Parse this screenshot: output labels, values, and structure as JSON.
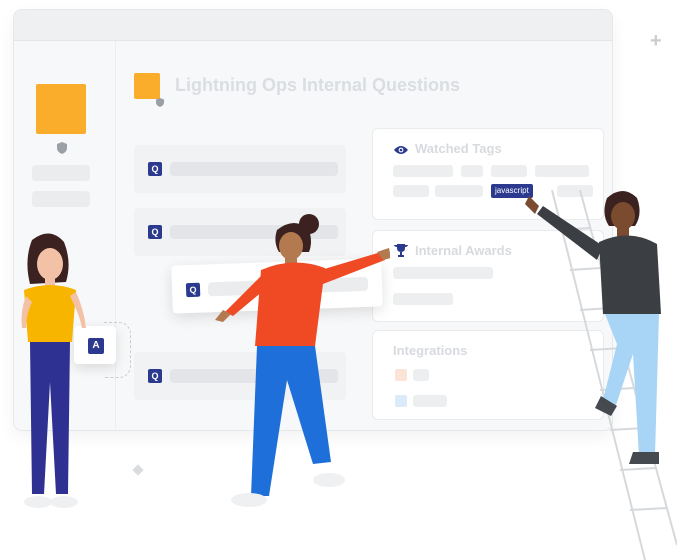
{
  "header": {
    "title": "Lightning Ops Internal Questions"
  },
  "cards": {
    "watched_tags": {
      "title": "Watched Tags",
      "highlight_tag": "javascript"
    },
    "internal_awards": {
      "title": "Internal Awards"
    },
    "integrations": {
      "title": "Integrations"
    }
  },
  "badges": {
    "question": "Q",
    "answer": "A"
  },
  "decor": {
    "plus": "+"
  },
  "colors": {
    "brand_orange": "#f9ad2a",
    "badge_navy": "#2b3a8f",
    "shirt_red": "#f04a24",
    "shirt_yellow": "#f7b500"
  }
}
